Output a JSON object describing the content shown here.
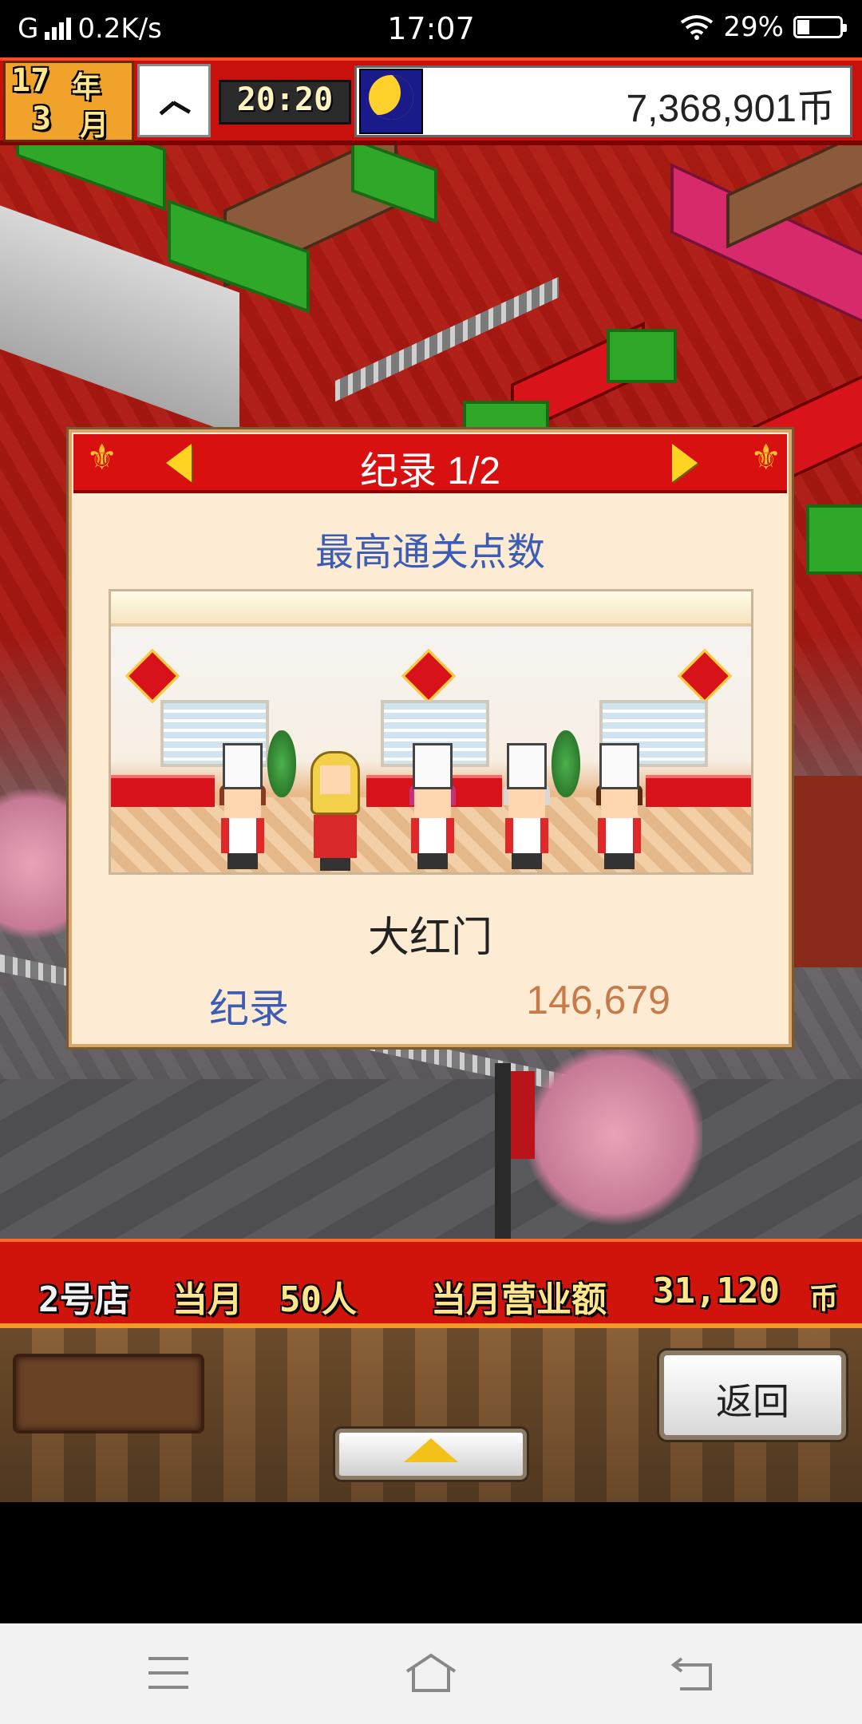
{
  "status_bar": {
    "network": "G",
    "speed": "0.2K/s",
    "time": "17:07",
    "battery": "29%",
    "battery_level_percent": 29,
    "icons": [
      "signal-icon",
      "wifi-icon",
      "battery-icon"
    ]
  },
  "top_bar": {
    "year_num": "17",
    "year_unit": "年",
    "month_num": "3",
    "month_unit": "月",
    "game_time": "20:20",
    "money": "7,368,901币",
    "icons": [
      "clock-icon",
      "moon-icon"
    ]
  },
  "dialog": {
    "title": "纪录 1/2",
    "subtitle": "最高通关点数",
    "restaurant_name": "大红门",
    "record_label": "纪录",
    "record_value": "146,679",
    "icons": [
      "prev-arrow-icon",
      "next-arrow-icon",
      "ornament-icon"
    ]
  },
  "bottom_bar": {
    "shop": "2号店",
    "month_label": "当月",
    "customers": "50人",
    "sales_label": "当月营业额",
    "sales_value": "31,120",
    "currency": "币"
  },
  "controls": {
    "back": "返回",
    "icons": [
      "expand-up-icon"
    ]
  },
  "nav_bar": {
    "icons": [
      "menu-icon",
      "home-icon",
      "back-icon"
    ]
  },
  "colors": {
    "header_red": "#d81010",
    "dialog_bg": "#fdecd3",
    "subtitle_blue": "#3c5db5",
    "record_orange": "#c77a4a",
    "pixel_yellow": "#ffe68a"
  }
}
